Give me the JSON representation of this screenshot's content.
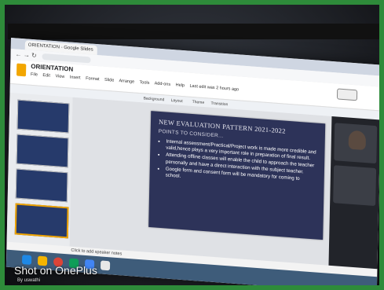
{
  "browser": {
    "tab_title": "ORIENTATION - Google Slides"
  },
  "slides_app": {
    "doc_title": "ORIENTATION",
    "menus": [
      "File",
      "Edit",
      "View",
      "Insert",
      "Format",
      "Slide",
      "Arrange",
      "Tools",
      "Add-ons",
      "Help",
      "Last edit was 2 hours ago"
    ],
    "toolbar_items": [
      "Background",
      "Layout",
      "Theme",
      "Transition"
    ],
    "speaker_notes_placeholder": "Click to add speaker notes"
  },
  "slide": {
    "title": "NEW EVALUATION PATTERN 2021-2022",
    "subtitle": "POINTS TO CONSIDER...",
    "bullets": [
      "Internal assessment/Practical/Project work is made more credible and valid,hence plays a very important role in preparation of final result.",
      "Attending offline classes will enable the child to approach the teacher personally and have a direct interaction with the subject teacher.",
      "Google form and consent form will be mandatory for coming to school."
    ]
  },
  "meeting_panel": {
    "participants": [
      "",
      ""
    ]
  },
  "watermark": {
    "main": "Shot on OnePlus",
    "by": "By uswathi"
  },
  "laptop": {
    "wordmark": ""
  },
  "colors": {
    "slide_bg": "#2d3359",
    "frame_green": "#2e8b3a",
    "slides_accent": "#f2a600"
  }
}
